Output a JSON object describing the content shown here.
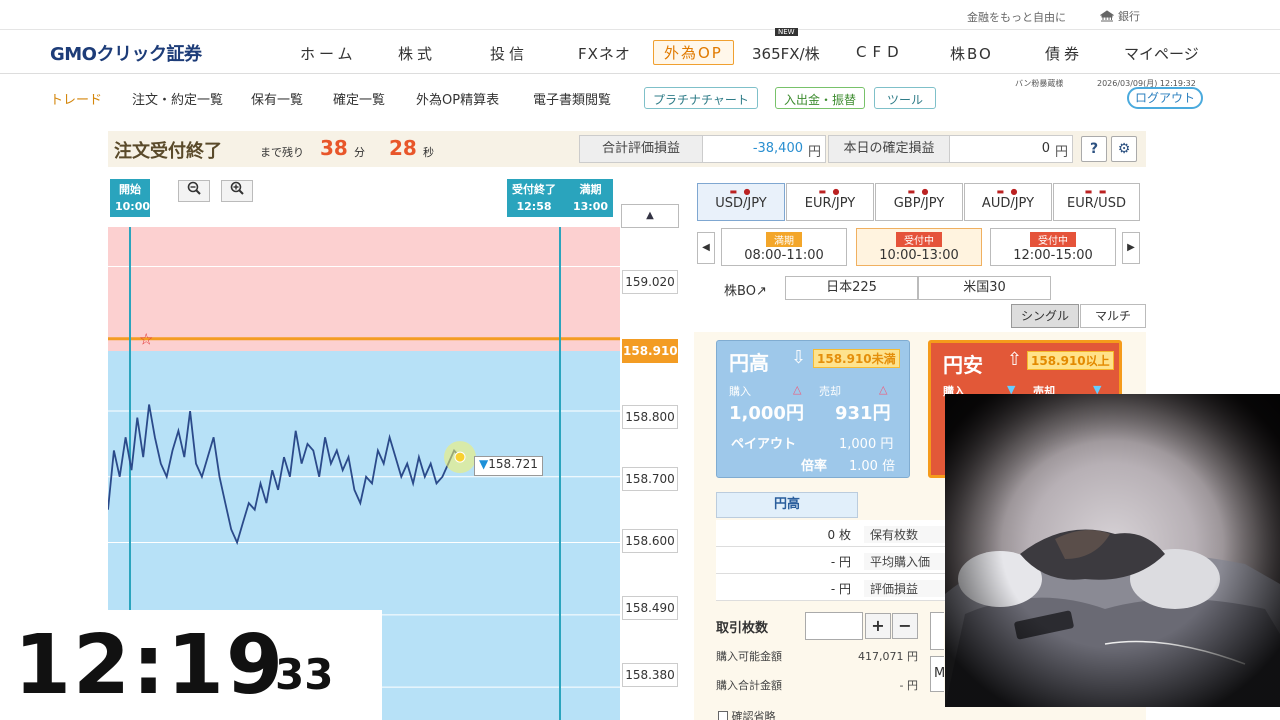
{
  "topbar": {
    "tagline": "金融をもっと自由に",
    "bank": "銀行"
  },
  "logo": {
    "text": "GMOクリック証券"
  },
  "nav": [
    {
      "label": "ホーム"
    },
    {
      "label": "株式"
    },
    {
      "label": "投信"
    },
    {
      "label": "FXネオ"
    },
    {
      "label": "外為OP",
      "active": true
    },
    {
      "label": "365FX/株"
    },
    {
      "label": "CFD"
    },
    {
      "label": "株BO"
    },
    {
      "label": "債券"
    },
    {
      "label": "マイページ"
    }
  ],
  "nav_badge": "NEW",
  "subnav": {
    "items": [
      "トレード",
      "注文・約定一覧",
      "保有一覧",
      "確定一覧",
      "外為OP精算表",
      "電子書類閲覧"
    ],
    "buttons": [
      "プラチナチャート",
      "入出金・振替",
      "ツール"
    ],
    "user": "バン粉暴蔵様",
    "datetime": "2026/03/09(月) 12:19:32",
    "logout": "ログアウト"
  },
  "status": {
    "title": "注文受付終了",
    "remain_label": "まで残り",
    "minutes": "38",
    "min_unit": "分",
    "seconds": "28",
    "sec_unit": "秒",
    "total_pl_label": "合計評価損益",
    "total_pl_value": "-38,400",
    "unit_yen": "円",
    "today_pl_label": "本日の確定損益",
    "today_pl_value": "0"
  },
  "chart_meta": {
    "start_label": "開始",
    "start_time": "10:00",
    "close_label": "受付終了",
    "close_time": "12:58",
    "expiry_label": "満期",
    "expiry_time": "13:00",
    "strike": "158.910",
    "current": "158.721",
    "price_ticks": [
      "159.020",
      "158.910",
      "158.800",
      "158.700",
      "158.600",
      "158.490",
      "158.380"
    ]
  },
  "chart_data": {
    "type": "line",
    "ylim": [
      158.33,
      159.08
    ],
    "xlim": [
      0,
      180
    ],
    "y": [
      158.65,
      158.74,
      158.7,
      158.76,
      158.71,
      158.79,
      158.73,
      158.81,
      158.76,
      158.72,
      158.7,
      158.74,
      158.77,
      158.73,
      158.8,
      158.72,
      158.7,
      158.73,
      158.76,
      158.7,
      158.66,
      158.62,
      158.6,
      158.63,
      158.66,
      158.65,
      158.69,
      158.66,
      158.71,
      158.68,
      158.73,
      158.7,
      158.77,
      158.72,
      158.75,
      158.74,
      158.7,
      158.76,
      158.72,
      158.74,
      158.71,
      158.73,
      158.68,
      158.66,
      158.7,
      158.69,
      158.74,
      158.72,
      158.76,
      158.73,
      158.7,
      158.72,
      158.69,
      158.73,
      158.7,
      158.72,
      158.69,
      158.7,
      158.72,
      158.74,
      158.73
    ]
  },
  "pairs": [
    {
      "label": "USD/JPY",
      "active": true
    },
    {
      "label": "EUR/JPY"
    },
    {
      "label": "GBP/JPY"
    },
    {
      "label": "AUD/JPY"
    },
    {
      "label": "EUR/USD"
    }
  ],
  "slots": [
    {
      "badge": "満期",
      "time": "08:00-11:00"
    },
    {
      "badge": "受付中",
      "time": "10:00-13:00",
      "active": true
    },
    {
      "badge": "受付中",
      "time": "12:00-15:00"
    }
  ],
  "kabubo": {
    "label": "株BO",
    "items": [
      "日本225",
      "米国30"
    ]
  },
  "modes": [
    "シングル",
    "マルチ"
  ],
  "cards": {
    "high": {
      "title": "円高",
      "cond": "158.910未満",
      "buy": "購入",
      "sell": "売却",
      "buy_price": "1,000",
      "sell_price": "931",
      "unit": "円",
      "payout_label": "ペイアウト",
      "payout": "1,000",
      "rate_label": "倍率",
      "rate": "1.00",
      "rate_unit": "倍"
    },
    "low": {
      "title": "円安",
      "cond": "158.910以上",
      "buy": "購入",
      "sell": "売却"
    }
  },
  "position": {
    "head": "円高",
    "rows": [
      {
        "value": "0 枚",
        "label": "保有枚数"
      },
      {
        "value": "- 円",
        "label": "平均購入価"
      },
      {
        "value": "- 円",
        "label": "評価損益"
      }
    ]
  },
  "order": {
    "qty_label": "取引枚数",
    "plus": "+",
    "minus": "−",
    "available_label": "購入可能金額",
    "available": "417,071 円",
    "total_label": "購入合計金額",
    "total": "- 円",
    "confirm": "確認省略"
  },
  "clock": {
    "hm": "12:19",
    "sec": "33"
  }
}
